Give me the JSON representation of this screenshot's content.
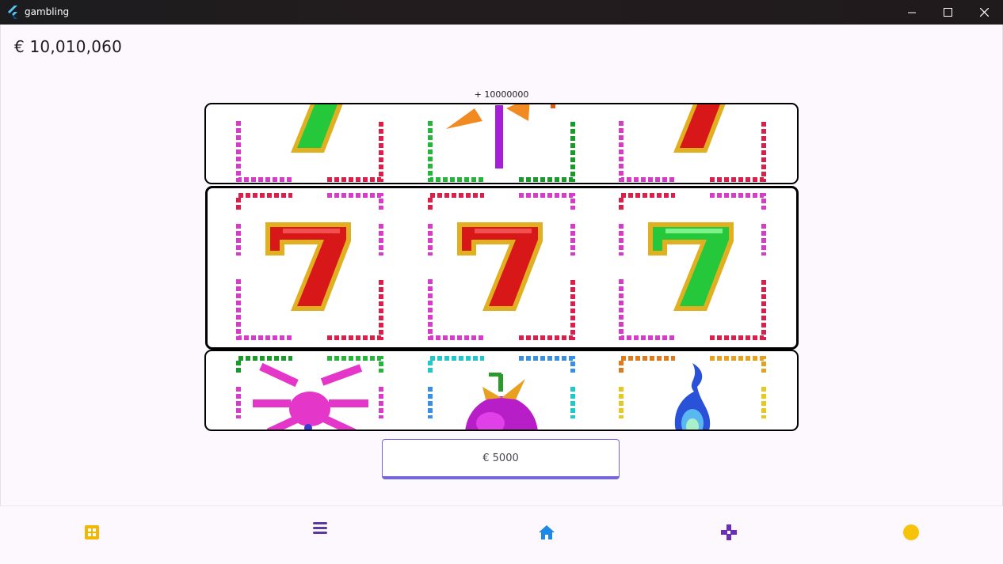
{
  "window": {
    "title": "gambling",
    "icon": "flutter-logo-icon",
    "controls": [
      "minimize-icon",
      "maximize-icon",
      "close-icon"
    ]
  },
  "balance": {
    "text": "€ 10,010,060"
  },
  "last_win": {
    "text": "+ 10000000"
  },
  "reels": {
    "top_row": [
      "green-seven-partial",
      "eggplant-partial",
      "red-seven-partial"
    ],
    "middle_row": [
      "red-seven",
      "red-seven",
      "green-seven"
    ],
    "bottom_row": [
      "pink-spider",
      "purple-fruit",
      "blue-flame"
    ]
  },
  "bet_button": {
    "label": "€ 5000"
  },
  "bottom_nav": {
    "items": [
      "grid-icon",
      "menu-icon",
      "home-icon",
      "gamepad-icon",
      "coin-icon"
    ]
  },
  "colors": {
    "accent": "#7467d9",
    "titlebar": "#1f1a1c",
    "grid_icon": "#f2b705",
    "menu_icon": "#5a3a9a",
    "home_icon": "#1e88e5",
    "gamepad_icon": "#6a2fb5",
    "coin_icon": "#f7c30a"
  }
}
